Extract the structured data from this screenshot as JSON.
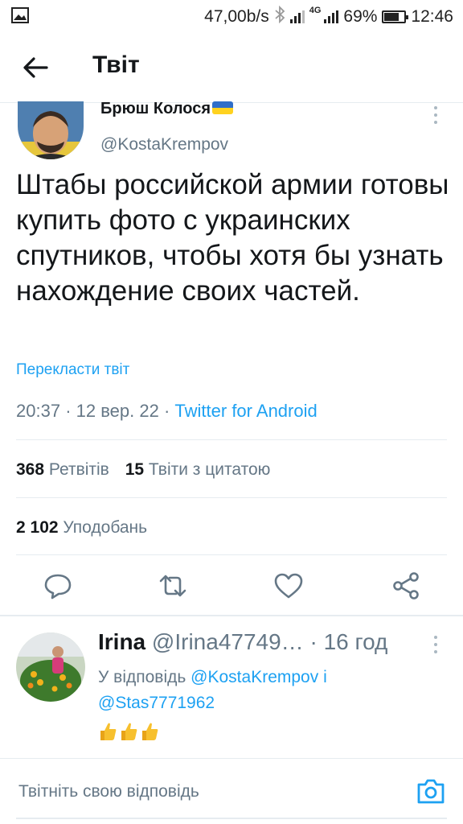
{
  "status_bar": {
    "network_speed": "47,00b/s",
    "network_type": "4G",
    "battery": "69%",
    "battery_level": 0.69,
    "time": "12:46"
  },
  "header": {
    "title": "Твіт"
  },
  "tweet": {
    "author_name": "Брюш Колося",
    "author_handle": "@KostaKrempov",
    "text": "Штабы российской армии готовы купить фото с украинских спутников, чтобы хотя бы узнать нахождение своих частей.",
    "translate_label": "Перекласти твіт",
    "time": "20:37",
    "date": "12 вер. 22",
    "client": "Twitter for Android",
    "retweets_count": "368",
    "retweets_label": "Ретвітів",
    "quotes_count": "15",
    "quotes_label": "Твіти з цитатою",
    "likes_count": "2 102",
    "likes_label": "Уподобань"
  },
  "reply": {
    "name": "Irina",
    "handle": "@Irina47749…",
    "time": "· 16 год",
    "reply_prefix": "У відповідь",
    "mention1": "@KostaKrempov",
    "conjunction": "і",
    "mention2": "@Stas7771962",
    "text": "👍👍👍"
  },
  "compose": {
    "placeholder": "Твітніть свою відповідь"
  },
  "colors": {
    "accent": "#1da1f2",
    "text": "#14171a",
    "secondary": "#657786",
    "divider": "#e6ecf0"
  }
}
